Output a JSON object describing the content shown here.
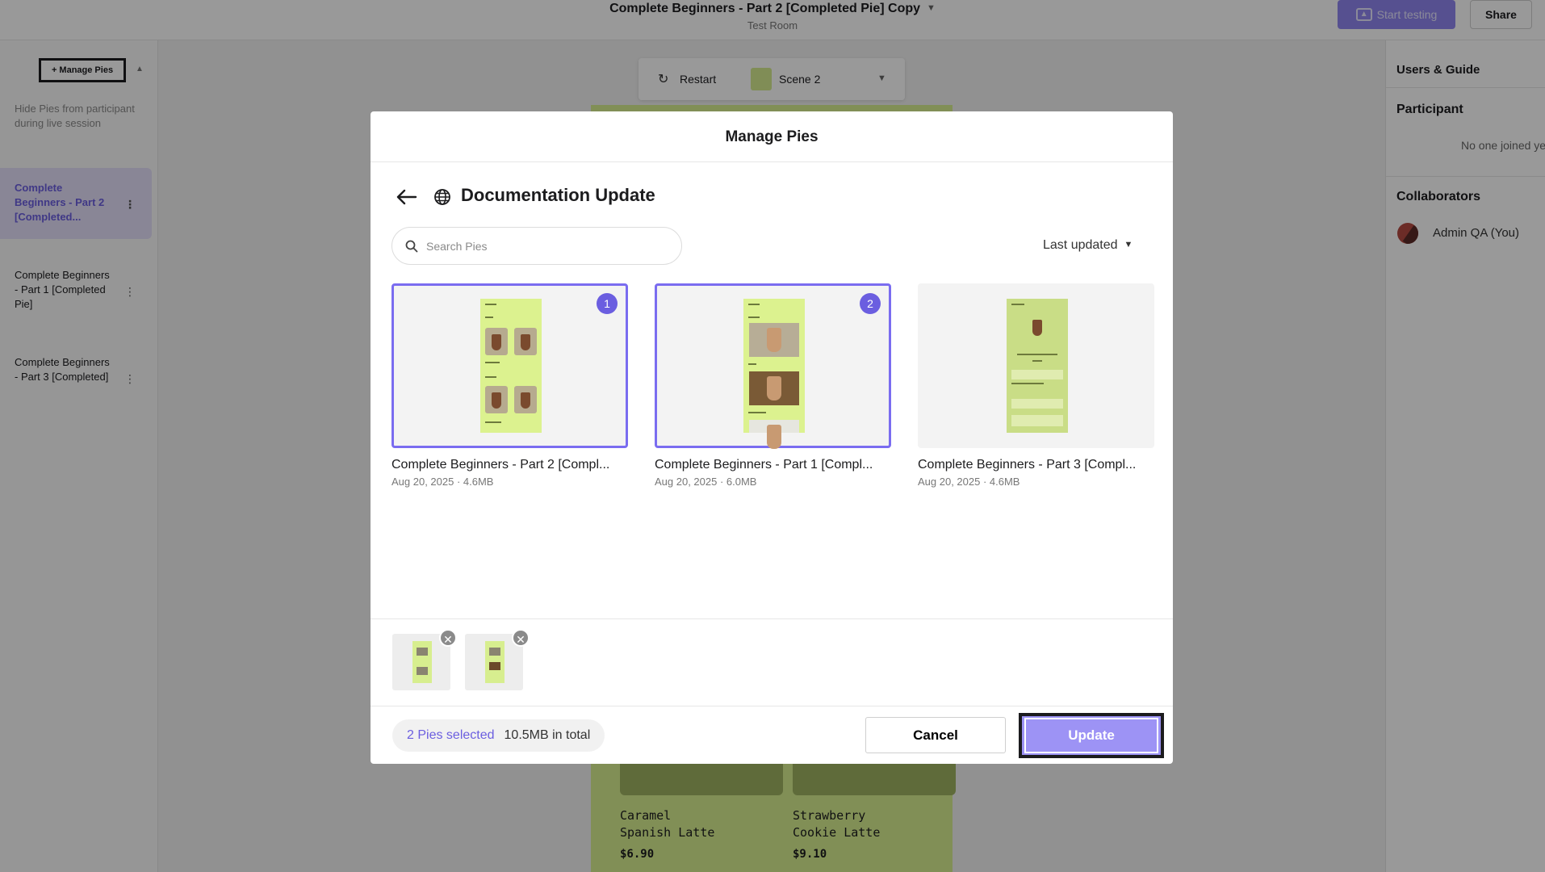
{
  "app": {
    "title": "Complete Beginners - Part 2 [Completed Pie] Copy",
    "subtitle": "Test Room",
    "start_testing": "Start testing",
    "share": "Share"
  },
  "left_panel": {
    "manage_pies": "+ Manage Pies",
    "hide_note": "Hide Pies from participant during live session",
    "items": [
      {
        "label": "Complete Beginners - Part 2 [Completed..."
      },
      {
        "label": "Complete Beginners - Part 1 [Completed Pie]"
      },
      {
        "label": "Complete Beginners - Part 3 [Completed]"
      }
    ]
  },
  "stage": {
    "restart": "Restart",
    "scene": "Scene 2",
    "items": [
      {
        "name_line1": "Caramel",
        "name_line2": "Spanish Latte",
        "price": "$6.90"
      },
      {
        "name_line1": "Strawberry",
        "name_line2": "Cookie Latte",
        "price": "$9.10"
      }
    ]
  },
  "right_panel": {
    "header": "Users & Guide",
    "participant": "Participant",
    "participant_empty": "No one joined ye",
    "collaborators": "Collaborators",
    "user": "Admin QA (You)"
  },
  "modal": {
    "title": "Manage Pies",
    "folder": "Documentation Update",
    "search_placeholder": "Search Pies",
    "sort": "Last updated",
    "cards": [
      {
        "name": "Complete Beginners - Part 2 [Compl...",
        "meta": "Aug 20, 2025 · 4.6MB",
        "badge": "1",
        "selected": true
      },
      {
        "name": "Complete Beginners - Part 1 [Compl...",
        "meta": "Aug 20, 2025 · 6.0MB",
        "badge": "2",
        "selected": true
      },
      {
        "name": "Complete Beginners - Part 3 [Compl...",
        "meta": "Aug 20, 2025 · 4.6MB",
        "badge": "",
        "selected": false
      }
    ],
    "selection_count": "2 Pies selected",
    "selection_total": "10.5MB in total",
    "cancel": "Cancel",
    "update": "Update",
    "remove_glyph": "✕"
  },
  "colors": {
    "accent": "#6b5ee0",
    "accent_light": "#9d93f5",
    "phone_bg": "#d7ee8f"
  }
}
